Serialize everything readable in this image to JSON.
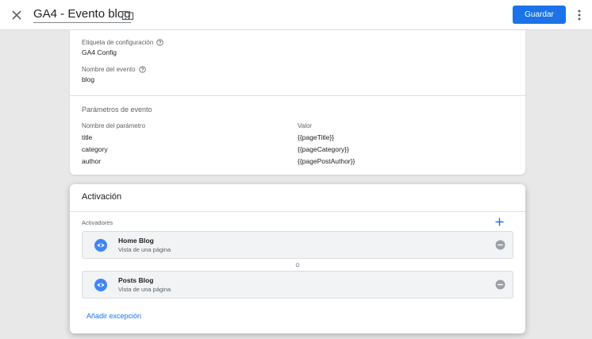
{
  "header": {
    "title": "GA4 - Evento blog",
    "save_label": "Guardar"
  },
  "config": {
    "config_tag_label": "Etiqueta de configuración",
    "config_tag_value": "GA4 Config",
    "event_name_label": "Nombre del evento",
    "event_name_value": "blog",
    "params_title": "Parámetros de evento",
    "param_name_header": "Nombre del parámetro",
    "param_value_header": "Valor",
    "params": [
      {
        "name": "title",
        "value": "{{pageTitle}}"
      },
      {
        "name": "category",
        "value": "{{pageCategory}}"
      },
      {
        "name": "author",
        "value": "{{pagePostAuthor}}"
      }
    ]
  },
  "activation": {
    "title": "Activación",
    "triggers_label": "Activadores",
    "or_label": "O",
    "triggers": [
      {
        "name": "Home Blog",
        "type": "Vista de una página"
      },
      {
        "name": "Posts Blog",
        "type": "Vista de una página"
      }
    ],
    "add_exception_label": "Añadir excepción"
  },
  "colors": {
    "accent": "#1a73e8",
    "trigger_icon": "#4285f4",
    "remove_icon": "#9aa0a6"
  }
}
